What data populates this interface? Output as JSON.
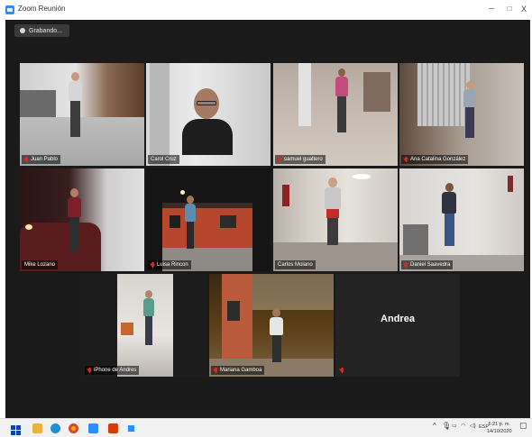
{
  "window": {
    "title": "Zoom Reunión",
    "minimize": "–",
    "maximize": "□",
    "close": "X"
  },
  "recording": {
    "label": "Grabando..."
  },
  "participants": [
    {
      "name": "Juan Pablo",
      "muted": true,
      "active": false
    },
    {
      "name": "Carol Cruz",
      "muted": false,
      "active": true
    },
    {
      "name": "samuel gualtero",
      "muted": true,
      "active": false
    },
    {
      "name": "Ana Catalina González",
      "muted": true,
      "active": false
    },
    {
      "name": "Mike Lozano",
      "muted": false,
      "active": false
    },
    {
      "name": "Luisa Rincon",
      "muted": true,
      "active": false
    },
    {
      "name": "Carlos Molano",
      "muted": false,
      "active": false
    },
    {
      "name": "Daniel Saavedra",
      "muted": true,
      "active": false
    },
    {
      "name": "iPhone de Andres",
      "muted": true,
      "active": false
    },
    {
      "name": "Mariana Gamboa",
      "muted": true,
      "active": false
    },
    {
      "name": "Andrea",
      "muted": true,
      "active": false,
      "video_off": true
    }
  ],
  "taskbar": {
    "tray_chevron": "^",
    "language": "ESP",
    "time": "6:21 p. m.",
    "date": "14/10/2020"
  },
  "colors": {
    "active_speaker": "#d9f26a",
    "muted_icon": "#e02828",
    "meeting_bg": "#1a1a1a"
  }
}
